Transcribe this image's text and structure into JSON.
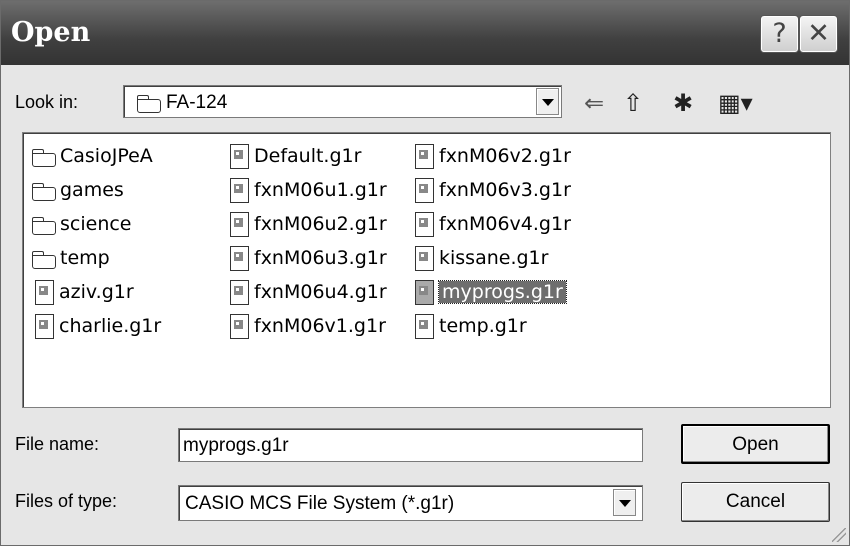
{
  "window": {
    "title": "Open",
    "help_glyph": "?",
    "close_glyph": "✕"
  },
  "lookin": {
    "label": "Look in:",
    "value": "FA-124"
  },
  "toolbar": {
    "back_glyph": "⇐",
    "up_glyph": "⇧",
    "new_folder_glyph": "✱",
    "views_glyph": "▦▾"
  },
  "files": {
    "col1": [
      {
        "name": "CasioJPeA",
        "type": "folder"
      },
      {
        "name": "games",
        "type": "folder"
      },
      {
        "name": "science",
        "type": "folder"
      },
      {
        "name": "temp",
        "type": "folder"
      },
      {
        "name": "aziv.g1r",
        "type": "file"
      },
      {
        "name": "charlie.g1r",
        "type": "file"
      }
    ],
    "col2": [
      {
        "name": "Default.g1r",
        "type": "file"
      },
      {
        "name": "fxnM06u1.g1r",
        "type": "file"
      },
      {
        "name": "fxnM06u2.g1r",
        "type": "file"
      },
      {
        "name": "fxnM06u3.g1r",
        "type": "file"
      },
      {
        "name": "fxnM06u4.g1r",
        "type": "file"
      },
      {
        "name": "fxnM06v1.g1r",
        "type": "file"
      }
    ],
    "col3": [
      {
        "name": "fxnM06v2.g1r",
        "type": "file"
      },
      {
        "name": "fxnM06v3.g1r",
        "type": "file"
      },
      {
        "name": "fxnM06v4.g1r",
        "type": "file"
      },
      {
        "name": "kissane.g1r",
        "type": "file"
      },
      {
        "name": "myprogs.g1r",
        "type": "file",
        "selected": true
      },
      {
        "name": "temp.g1r",
        "type": "file"
      }
    ]
  },
  "filename": {
    "label": "File name:",
    "value": "myprogs.g1r"
  },
  "filetype": {
    "label": "Files of type:",
    "value": "CASIO MCS File System (*.g1r)"
  },
  "buttons": {
    "open": "Open",
    "cancel": "Cancel"
  }
}
